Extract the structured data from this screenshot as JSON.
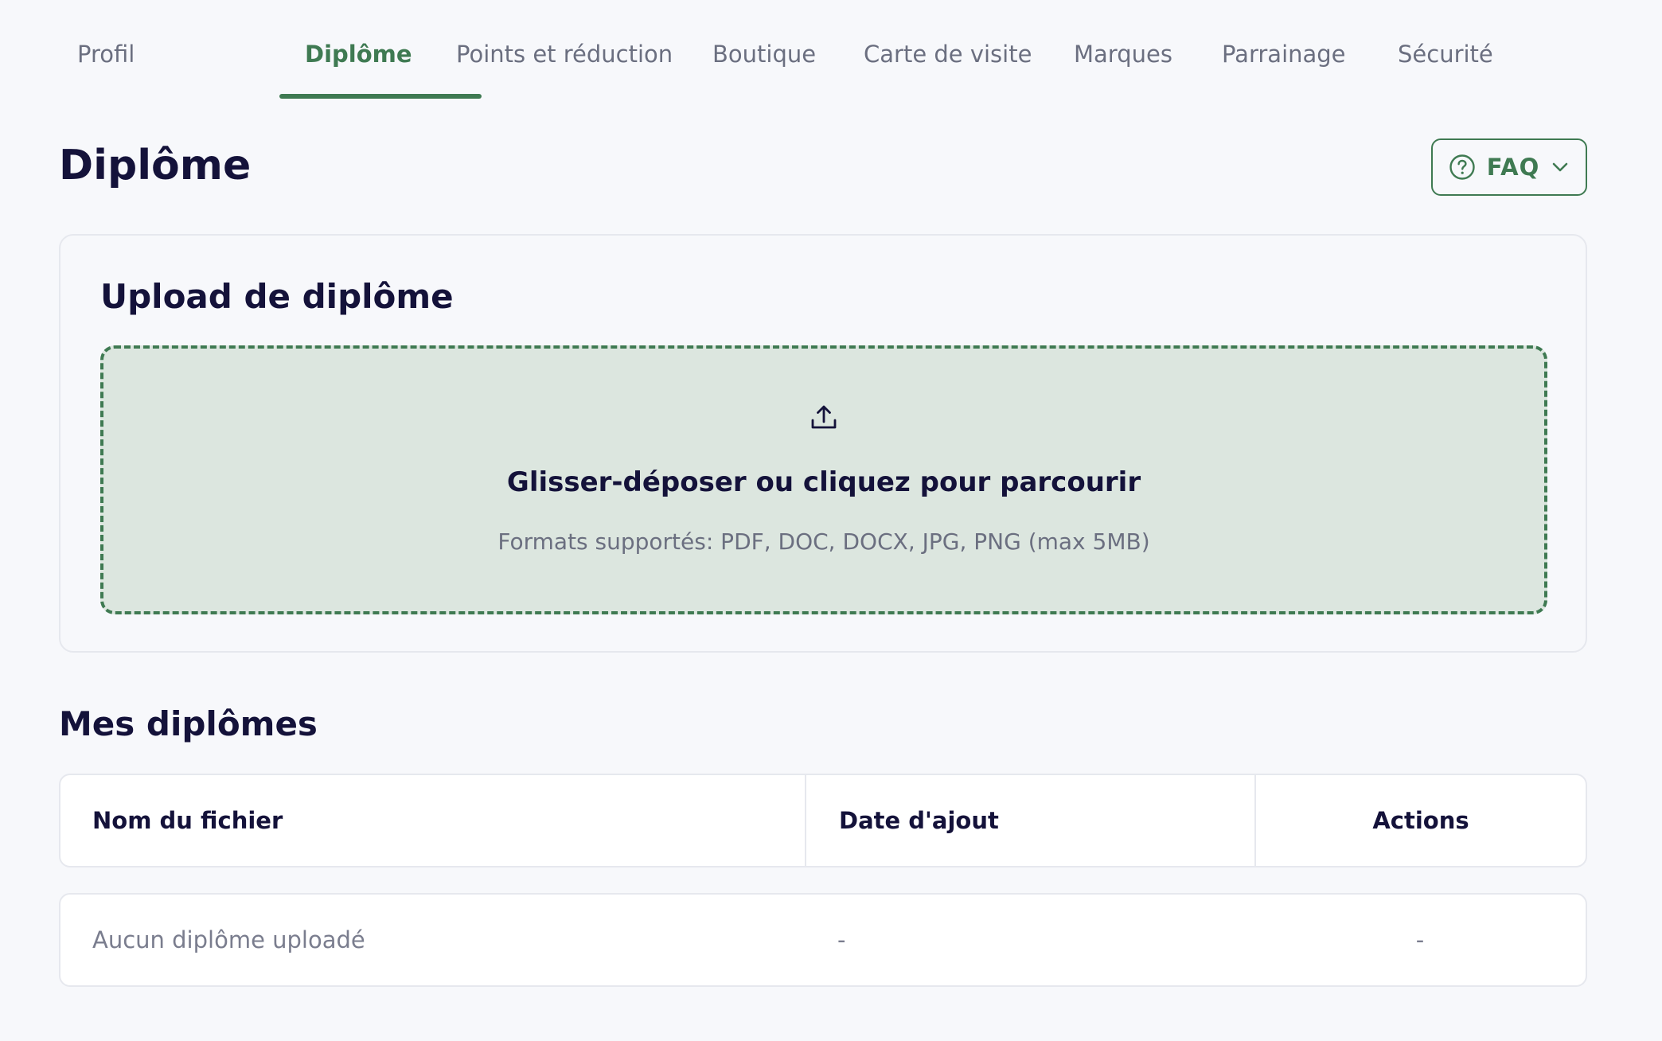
{
  "tabs": [
    {
      "label": "Profil",
      "active": false
    },
    {
      "label": "Diplôme",
      "active": true
    },
    {
      "label": "Points et réduction",
      "active": false
    },
    {
      "label": "Boutique",
      "active": false
    },
    {
      "label": "Carte de visite",
      "active": false
    },
    {
      "label": "Marques",
      "active": false
    },
    {
      "label": "Parrainage",
      "active": false
    },
    {
      "label": "Sécurité",
      "active": false
    }
  ],
  "header": {
    "title": "Diplôme",
    "faq_label": "FAQ",
    "faq_icons": [
      "question-circle-icon",
      "chevron-down-icon"
    ]
  },
  "upload": {
    "title": "Upload de diplôme",
    "icon": "upload-icon",
    "drop_text": "Glisser-déposer ou cliquez pour parcourir",
    "formats_text": "Formats supportés: PDF, DOC, DOCX, JPG, PNG (max 5MB)"
  },
  "diplomas": {
    "title": "Mes diplômes",
    "columns": [
      "Nom du fichier",
      "Date d'ajout",
      "Actions"
    ],
    "rows": [
      [
        "Aucun diplôme uploadé",
        "-",
        "-"
      ]
    ]
  },
  "colors": {
    "accent": "#3f7a52",
    "dropzone_bg": "#dce6df",
    "page_bg": "#f7f8fb",
    "heading": "#14123a",
    "muted": "#6b6f80"
  }
}
